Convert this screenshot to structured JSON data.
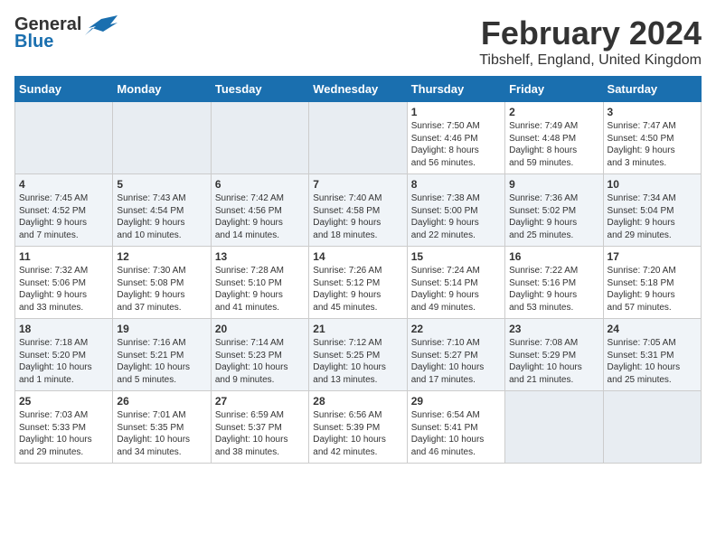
{
  "logo": {
    "text_general": "General",
    "text_blue": "Blue"
  },
  "title": "February 2024",
  "location": "Tibshelf, England, United Kingdom",
  "headers": [
    "Sunday",
    "Monday",
    "Tuesday",
    "Wednesday",
    "Thursday",
    "Friday",
    "Saturday"
  ],
  "rows": [
    [
      {
        "day": "",
        "content": ""
      },
      {
        "day": "",
        "content": ""
      },
      {
        "day": "",
        "content": ""
      },
      {
        "day": "",
        "content": ""
      },
      {
        "day": "1",
        "content": "Sunrise: 7:50 AM\nSunset: 4:46 PM\nDaylight: 8 hours\nand 56 minutes."
      },
      {
        "day": "2",
        "content": "Sunrise: 7:49 AM\nSunset: 4:48 PM\nDaylight: 8 hours\nand 59 minutes."
      },
      {
        "day": "3",
        "content": "Sunrise: 7:47 AM\nSunset: 4:50 PM\nDaylight: 9 hours\nand 3 minutes."
      }
    ],
    [
      {
        "day": "4",
        "content": "Sunrise: 7:45 AM\nSunset: 4:52 PM\nDaylight: 9 hours\nand 7 minutes."
      },
      {
        "day": "5",
        "content": "Sunrise: 7:43 AM\nSunset: 4:54 PM\nDaylight: 9 hours\nand 10 minutes."
      },
      {
        "day": "6",
        "content": "Sunrise: 7:42 AM\nSunset: 4:56 PM\nDaylight: 9 hours\nand 14 minutes."
      },
      {
        "day": "7",
        "content": "Sunrise: 7:40 AM\nSunset: 4:58 PM\nDaylight: 9 hours\nand 18 minutes."
      },
      {
        "day": "8",
        "content": "Sunrise: 7:38 AM\nSunset: 5:00 PM\nDaylight: 9 hours\nand 22 minutes."
      },
      {
        "day": "9",
        "content": "Sunrise: 7:36 AM\nSunset: 5:02 PM\nDaylight: 9 hours\nand 25 minutes."
      },
      {
        "day": "10",
        "content": "Sunrise: 7:34 AM\nSunset: 5:04 PM\nDaylight: 9 hours\nand 29 minutes."
      }
    ],
    [
      {
        "day": "11",
        "content": "Sunrise: 7:32 AM\nSunset: 5:06 PM\nDaylight: 9 hours\nand 33 minutes."
      },
      {
        "day": "12",
        "content": "Sunrise: 7:30 AM\nSunset: 5:08 PM\nDaylight: 9 hours\nand 37 minutes."
      },
      {
        "day": "13",
        "content": "Sunrise: 7:28 AM\nSunset: 5:10 PM\nDaylight: 9 hours\nand 41 minutes."
      },
      {
        "day": "14",
        "content": "Sunrise: 7:26 AM\nSunset: 5:12 PM\nDaylight: 9 hours\nand 45 minutes."
      },
      {
        "day": "15",
        "content": "Sunrise: 7:24 AM\nSunset: 5:14 PM\nDaylight: 9 hours\nand 49 minutes."
      },
      {
        "day": "16",
        "content": "Sunrise: 7:22 AM\nSunset: 5:16 PM\nDaylight: 9 hours\nand 53 minutes."
      },
      {
        "day": "17",
        "content": "Sunrise: 7:20 AM\nSunset: 5:18 PM\nDaylight: 9 hours\nand 57 minutes."
      }
    ],
    [
      {
        "day": "18",
        "content": "Sunrise: 7:18 AM\nSunset: 5:20 PM\nDaylight: 10 hours\nand 1 minute."
      },
      {
        "day": "19",
        "content": "Sunrise: 7:16 AM\nSunset: 5:21 PM\nDaylight: 10 hours\nand 5 minutes."
      },
      {
        "day": "20",
        "content": "Sunrise: 7:14 AM\nSunset: 5:23 PM\nDaylight: 10 hours\nand 9 minutes."
      },
      {
        "day": "21",
        "content": "Sunrise: 7:12 AM\nSunset: 5:25 PM\nDaylight: 10 hours\nand 13 minutes."
      },
      {
        "day": "22",
        "content": "Sunrise: 7:10 AM\nSunset: 5:27 PM\nDaylight: 10 hours\nand 17 minutes."
      },
      {
        "day": "23",
        "content": "Sunrise: 7:08 AM\nSunset: 5:29 PM\nDaylight: 10 hours\nand 21 minutes."
      },
      {
        "day": "24",
        "content": "Sunrise: 7:05 AM\nSunset: 5:31 PM\nDaylight: 10 hours\nand 25 minutes."
      }
    ],
    [
      {
        "day": "25",
        "content": "Sunrise: 7:03 AM\nSunset: 5:33 PM\nDaylight: 10 hours\nand 29 minutes."
      },
      {
        "day": "26",
        "content": "Sunrise: 7:01 AM\nSunset: 5:35 PM\nDaylight: 10 hours\nand 34 minutes."
      },
      {
        "day": "27",
        "content": "Sunrise: 6:59 AM\nSunset: 5:37 PM\nDaylight: 10 hours\nand 38 minutes."
      },
      {
        "day": "28",
        "content": "Sunrise: 6:56 AM\nSunset: 5:39 PM\nDaylight: 10 hours\nand 42 minutes."
      },
      {
        "day": "29",
        "content": "Sunrise: 6:54 AM\nSunset: 5:41 PM\nDaylight: 10 hours\nand 46 minutes."
      },
      {
        "day": "",
        "content": ""
      },
      {
        "day": "",
        "content": ""
      }
    ]
  ]
}
